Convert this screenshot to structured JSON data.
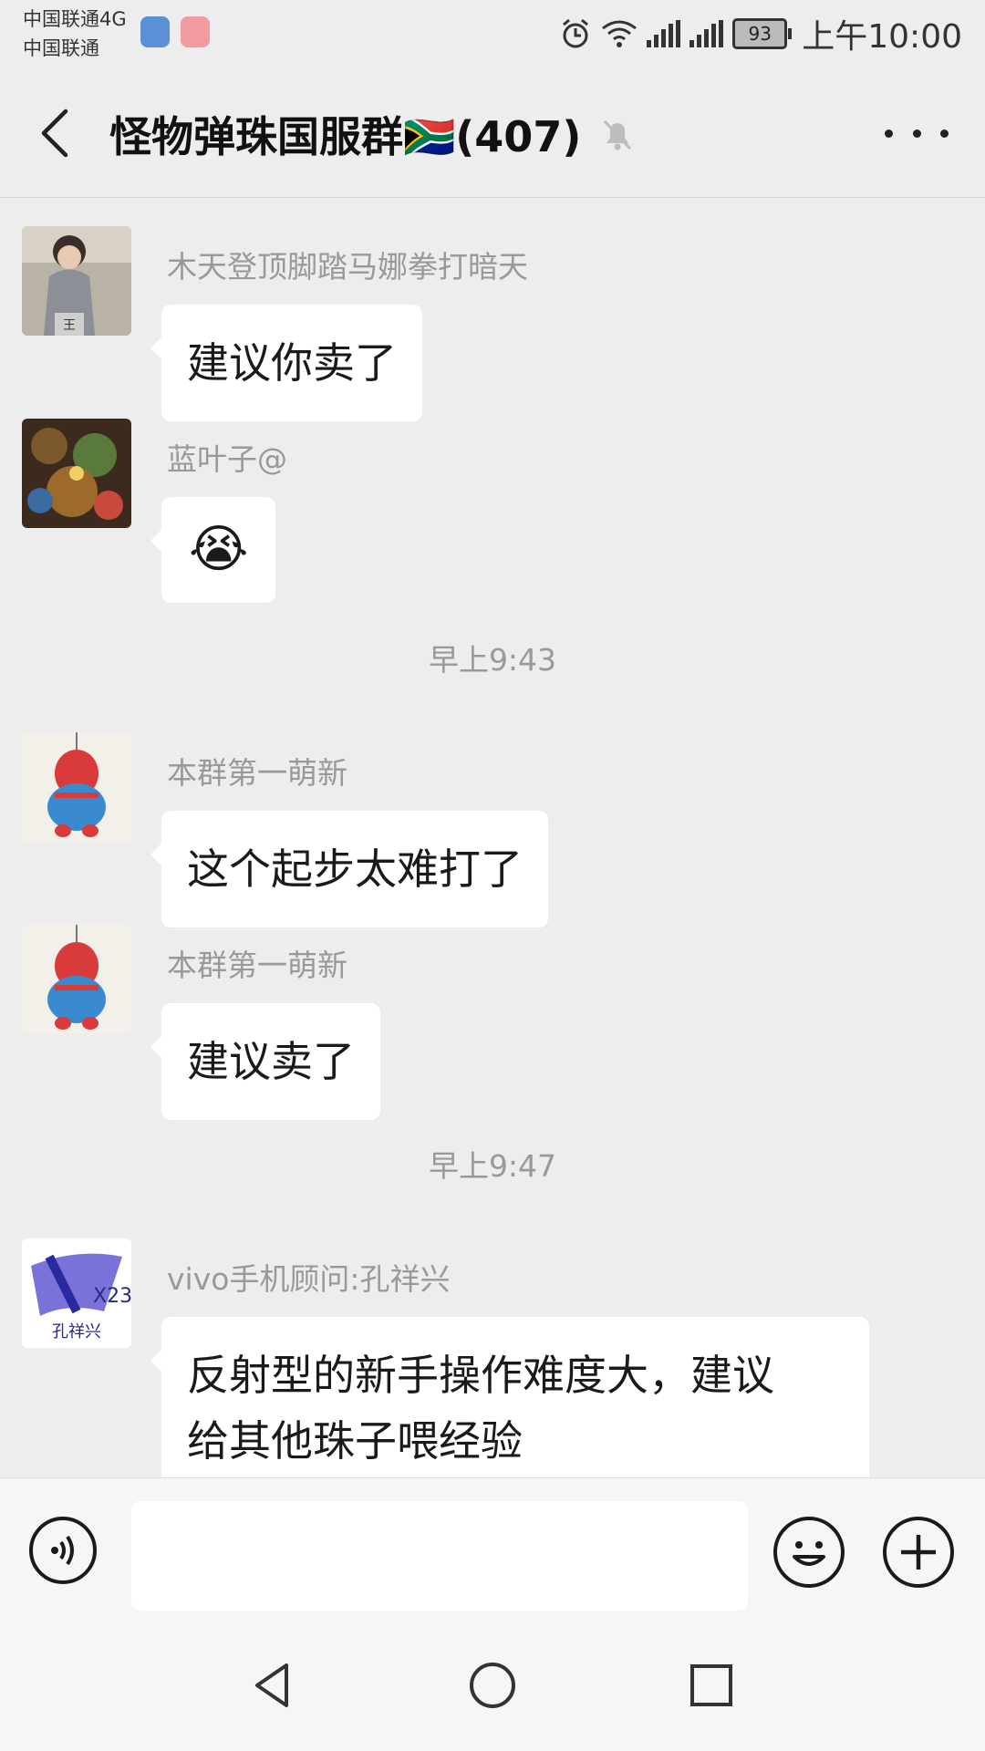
{
  "status_bar": {
    "carrier_line1": "中国联通4G",
    "carrier_line2": "中国联通",
    "battery": "93",
    "time": "上午10:00",
    "icons": [
      "shield-icon",
      "app-emoji-icon",
      "alarm-icon",
      "wifi-icon",
      "signal-4g-icon",
      "signal-e-icon",
      "battery-icon"
    ]
  },
  "header": {
    "title": "怪物弹珠国服群🇿🇦(407)",
    "back_icon": "back-chevron-icon",
    "mute_icon": "bell-muted-icon",
    "more_icon": "more-dots-icon"
  },
  "messages": [
    {
      "type": "text",
      "sender": "木天登顶脚踏马娜拳打暗天",
      "text": [
        "建议你卖了"
      ],
      "avatar": "avatar-child"
    },
    {
      "type": "emoji",
      "sender": "蓝叶子@",
      "text": [
        "😭"
      ],
      "avatar": "avatar-game"
    },
    {
      "type": "timestamp",
      "text": "早上9:43"
    },
    {
      "type": "text",
      "sender": "本群第一萌新",
      "text": [
        "这个起步太难打了"
      ],
      "avatar": "avatar-spiderman"
    },
    {
      "type": "text",
      "sender": "本群第一萌新",
      "text": [
        "建议卖了"
      ],
      "avatar": "avatar-spiderman"
    },
    {
      "type": "timestamp",
      "text": "早上9:47"
    },
    {
      "type": "text",
      "sender": "vivo手机顾问:孔祥兴",
      "text": [
        "反射型的新手操作难度大，建议",
        "给其他珠子喂经验"
      ],
      "avatar": "avatar-vivo"
    }
  ],
  "avatar_vivo": {
    "model": "X23",
    "name": "孔祥兴"
  },
  "avatar_child_label": "王",
  "input_bar": {
    "placeholder": "",
    "voice_icon": "voice-icon",
    "emoji_icon": "emoji-icon",
    "plus_icon": "plus-icon"
  },
  "nav_bar": {
    "icons": [
      "nav-back-icon",
      "nav-home-icon",
      "nav-recents-icon"
    ]
  }
}
